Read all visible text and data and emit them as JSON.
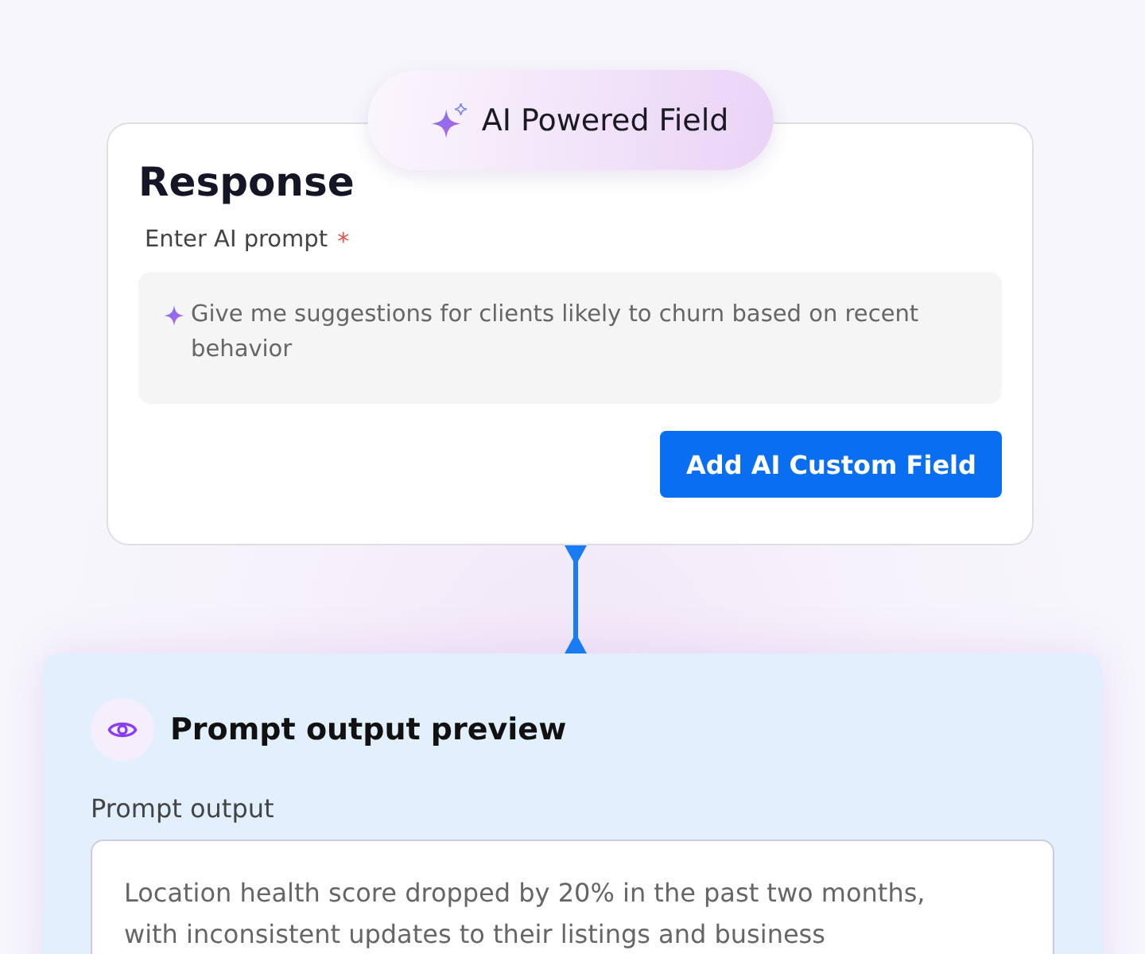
{
  "badge": {
    "label": "AI Powered Field"
  },
  "response_card": {
    "title": "Response",
    "field_label": "Enter AI prompt",
    "required_mark": "*",
    "prompt_value": "Give me suggestions for clients likely to churn based on recent behavior",
    "button": "Add AI Custom Field"
  },
  "preview_card": {
    "title": "Prompt output preview",
    "field_label": "Prompt output",
    "output_lines": [
      "Location health score dropped by 20% in the past two months,",
      "with inconsistent updates to their listings and business"
    ]
  }
}
